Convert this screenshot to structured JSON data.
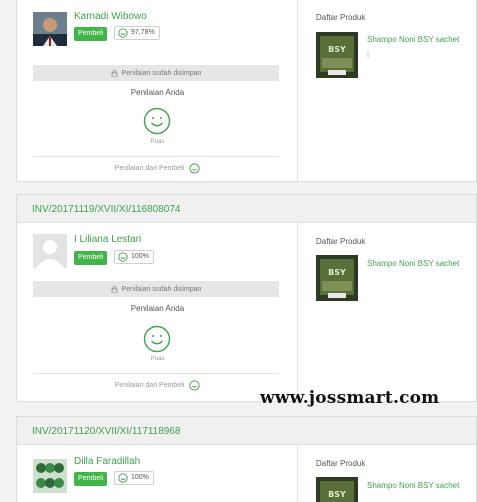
{
  "colors": {
    "accent": "#42a050",
    "badge": "#42b549"
  },
  "product_list_label": "Daftar Produk",
  "orders": [
    {
      "invoice": "",
      "buyer_name": "Karnadi Wibowo",
      "buyer_badge": "Pembeli",
      "buyer_rating": "97,78%",
      "review_saved": "Penilaian sudah disimpan",
      "your_rating_label": "Penilaian Anda",
      "rating_value": "Puas",
      "from_buyer_label": "Penilaian dari Pembeli",
      "product_name": "Shampo Noni BSY sachet",
      "product_note": "|"
    },
    {
      "invoice": "INV/20171119/XVII/XI/116808074",
      "buyer_name": "I Liliana Lestari",
      "buyer_badge": "Pembeli",
      "buyer_rating": "100%",
      "review_saved": "Penilaian sudah disimpan",
      "your_rating_label": "Penilaian Anda",
      "rating_value": "Puas",
      "from_buyer_label": "Penilaian dari Pembeli",
      "product_name": "Shampo Noni BSY sachet"
    },
    {
      "invoice": "INV/20171120/XVII/XI/117118968",
      "buyer_name": "Dilla Faradillah",
      "buyer_badge": "Pembeli",
      "buyer_rating": "100%",
      "product_name": "Shampo Noni BSY sachet"
    }
  ],
  "watermark": "www.jossmart.com",
  "icons": {
    "lock": "lock-icon",
    "smile": "smile-icon"
  }
}
